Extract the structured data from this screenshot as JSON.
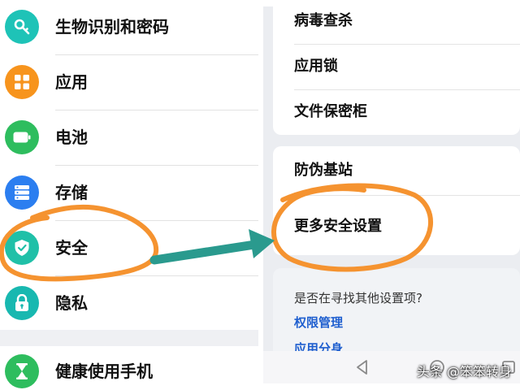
{
  "left": {
    "items": [
      {
        "label": "生物识别和密码",
        "icon": "key-icon",
        "color": "#1ec3b7"
      },
      {
        "label": "应用",
        "icon": "apps-grid-icon",
        "color": "#f7941d"
      },
      {
        "label": "电池",
        "icon": "battery-icon",
        "color": "#2ebd5e"
      },
      {
        "label": "存储",
        "icon": "storage-icon",
        "color": "#2b7ef0"
      },
      {
        "label": "安全",
        "icon": "shield-icon",
        "color": "#20c0a8"
      },
      {
        "label": "隐私",
        "icon": "lock-icon",
        "color": "#18b8b0"
      },
      {
        "label": "健康使用手机",
        "icon": "hourglass-icon",
        "color": "#2ebd5e"
      }
    ]
  },
  "right": {
    "card1": [
      "病毒查杀",
      "应用锁",
      "文件保密柜"
    ],
    "card2": [
      "防伪基站",
      "更多安全设置"
    ],
    "search_card": {
      "title": "是否在寻找其他设置项?",
      "links": [
        "权限管理",
        "应用分身"
      ]
    }
  },
  "watermark": "头条 @笨笨转身",
  "colors": {
    "annotation_orange": "#f59330",
    "arrow_teal": "#2a9a8e",
    "link_blue": "#1f5fcf"
  }
}
